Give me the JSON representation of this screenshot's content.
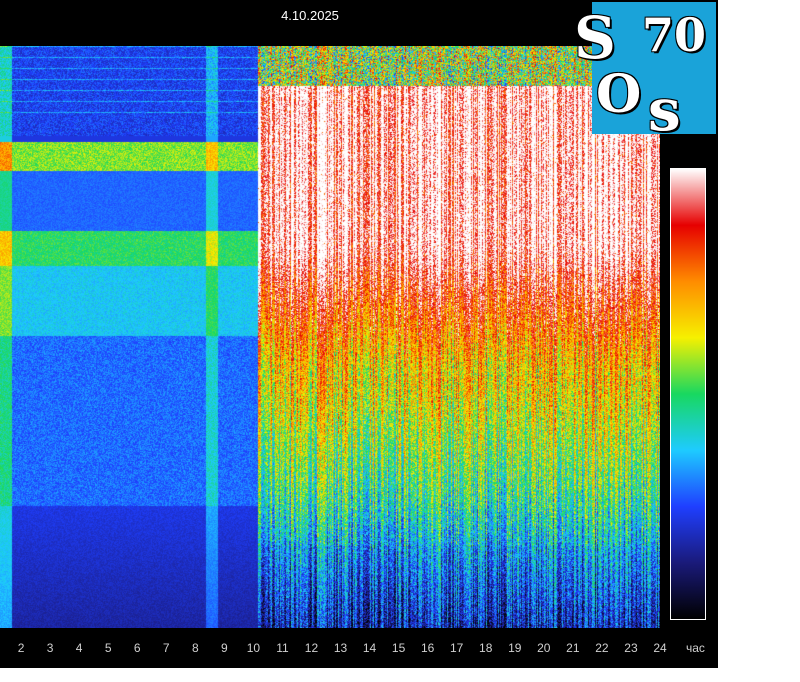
{
  "date": "4.10.2025",
  "logo": {
    "s1": "S",
    "num": "70",
    "o": "O",
    "s2": "s"
  },
  "chart_data": {
    "type": "heatmap",
    "x_ticks": [
      "2",
      "3",
      "4",
      "5",
      "6",
      "7",
      "8",
      "9",
      "10",
      "11",
      "12",
      "13",
      "14",
      "15",
      "16",
      "17",
      "18",
      "19",
      "20",
      "21",
      "22",
      "23",
      "24"
    ],
    "x_unit": "час",
    "xlim": [
      1,
      24
    ],
    "colorbar": [
      "#000000",
      "#1a1a7a",
      "#1f3fff",
      "#1ecbff",
      "#18d860",
      "#f6f000",
      "#ff8c00",
      "#e60000",
      "#ffffff"
    ]
  }
}
